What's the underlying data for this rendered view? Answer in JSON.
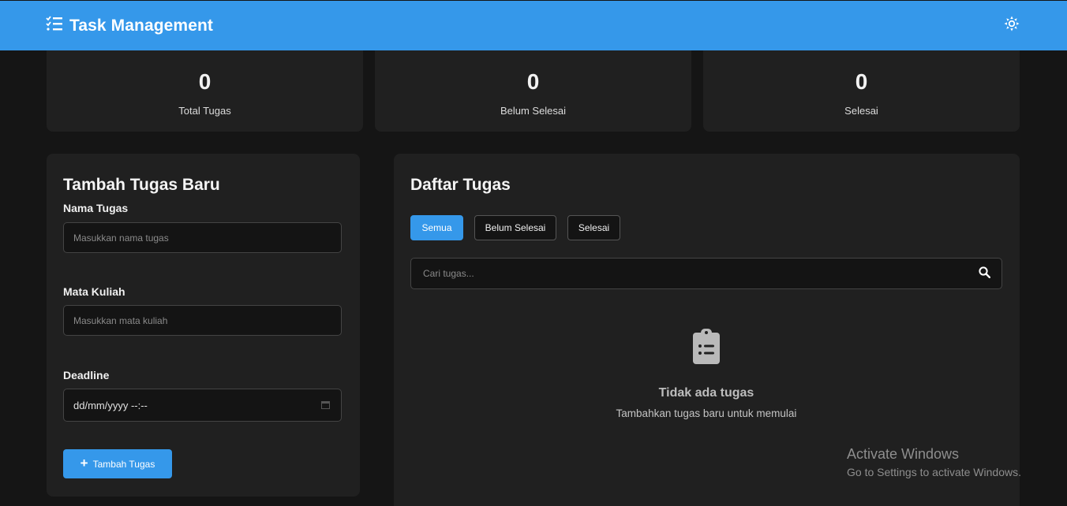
{
  "navbar": {
    "title": "Task Management",
    "brand_icon": "list-check-icon",
    "theme_icon": "sun-icon",
    "color": "#3598ea"
  },
  "stats": [
    {
      "value": "0",
      "label": "Total Tugas"
    },
    {
      "value": "0",
      "label": "Belum Selesai"
    },
    {
      "value": "0",
      "label": "Selesai"
    }
  ],
  "form": {
    "title": "Tambah Tugas Baru",
    "name_label": "Nama Tugas",
    "name_placeholder": "Masukkan nama tugas",
    "course_label": "Mata Kuliah",
    "course_placeholder": "Masukkan mata kuliah",
    "deadline_label": "Deadline",
    "deadline_placeholder": "dd/mm/yyyy --:--",
    "submit_label": "Tambah Tugas",
    "submit_icon": "plus-icon"
  },
  "tasks": {
    "title": "Daftar Tugas",
    "filters": [
      {
        "label": "Semua",
        "active": true
      },
      {
        "label": "Belum Selesai",
        "active": false
      },
      {
        "label": "Selesai",
        "active": false
      }
    ],
    "search_placeholder": "Cari tugas...",
    "search_icon": "search-icon",
    "empty_icon": "clipboard-list-icon",
    "empty_title": "Tidak ada tugas",
    "empty_subtitle": "Tambahkan tugas baru untuk memulai"
  },
  "watermark": {
    "title": "Activate Windows",
    "subtitle": "Go to Settings to activate Windows."
  }
}
